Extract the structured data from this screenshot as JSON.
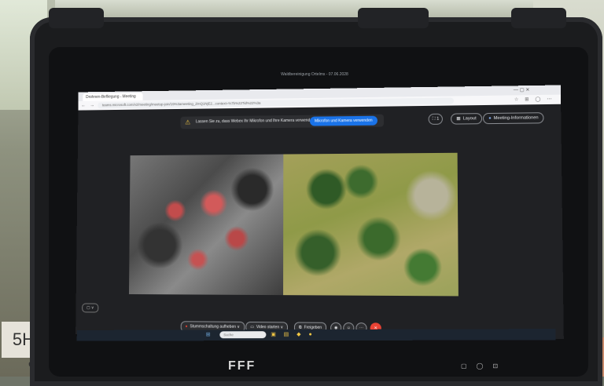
{
  "environment": {
    "label_text": "5H"
  },
  "device": {
    "brand": "FFF"
  },
  "browser": {
    "tab_title": "Drohnen-Befliegung - Meeting",
    "url": "teams.microsoft.com/v2/meeting/meetup-join/19%3ameeting_ZmQ1NjE2...context=%7b%22Tid%22%3a",
    "nav_icons": "← → ⟳",
    "tool_icons": "☆ ⊞ ◯ ⋯",
    "window_controls": "—  ▢  ✕"
  },
  "meeting": {
    "caption": "Waldbereinigung Ortelms - 07.06.2028",
    "notice_icon": "⚠",
    "notice_text": "Lassen Sie zu, dass Webex Ihr Mikrofon und Ihre Kamera verwenden darf",
    "notice_button": "Mikrofon und Kamera verwenden",
    "small_button": "⛶ 1",
    "layout_label": "Layout",
    "info_label": "Meeting-Informationen",
    "rec_label": "Stummschaltung aufheben",
    "video_label": "Video starten",
    "share_label": "Freigeben",
    "side_ctrl": "▢ ∨",
    "colors": {
      "accent": "#1a73e8",
      "hangup": "#ea4335",
      "background": "#202124"
    }
  },
  "taskbar": {
    "search_placeholder": "Suche",
    "icons_left": "⊞",
    "icons_right": "▣ ▤ ◆ ●"
  }
}
